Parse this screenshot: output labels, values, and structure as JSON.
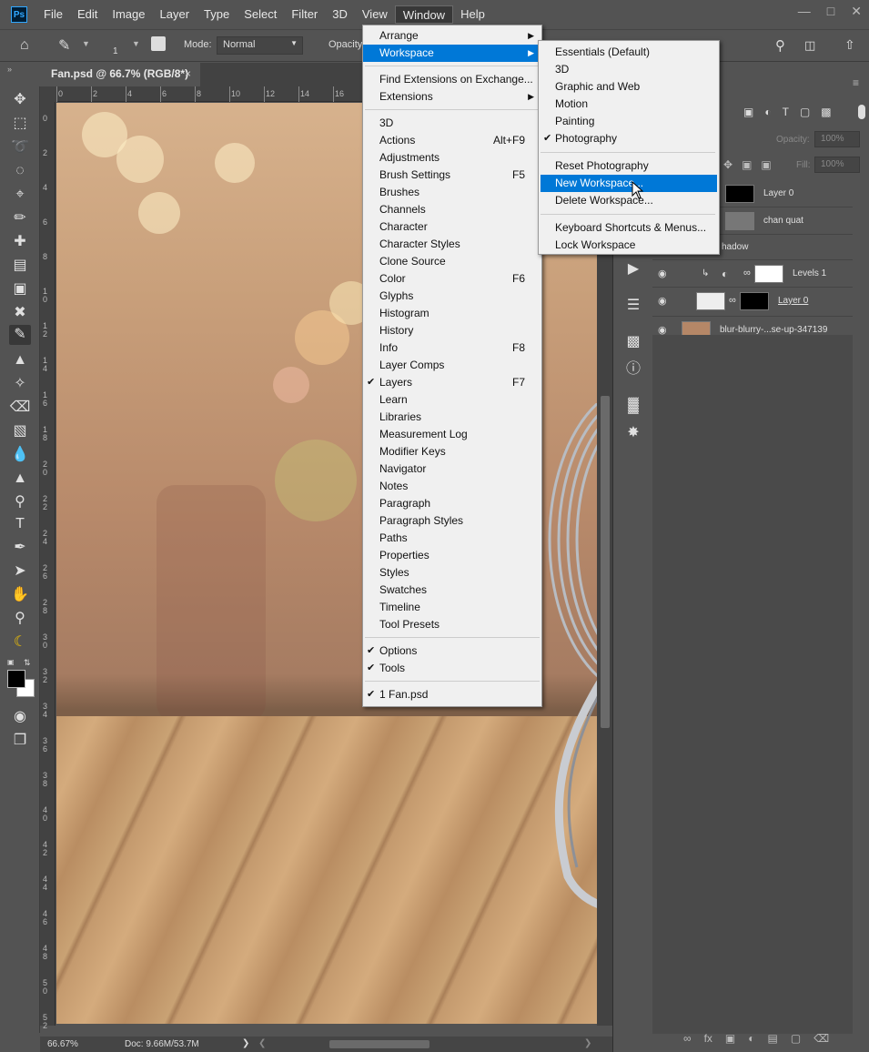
{
  "menubar": {
    "logo": "Ps",
    "items": [
      "File",
      "Edit",
      "Image",
      "Layer",
      "Type",
      "Select",
      "Filter",
      "3D",
      "View",
      "Window",
      "Help"
    ],
    "active_item": "Window"
  },
  "options": {
    "mode_label": "Mode:",
    "mode_value": "Normal",
    "opacity_label": "Opacity:",
    "brush_size": "1"
  },
  "document": {
    "tab_title": "Fan.psd @ 66.7% (RGB/8*)",
    "zoom": "66.67%",
    "doc_size": "Doc: 9.66M/53.7M",
    "hruler_ticks": [
      "0",
      "2",
      "4",
      "6",
      "8",
      "10",
      "12",
      "14",
      "16"
    ],
    "vruler_ticks": [
      "0",
      "2",
      "4",
      "6",
      "8",
      "1 0",
      "1 2",
      "1 4",
      "1 6",
      "1 8",
      "2 0",
      "2 2",
      "2 4",
      "2 6",
      "2 8",
      "3 0",
      "3 2",
      "3 4",
      "3 6",
      "3 8",
      "4 0",
      "4 2",
      "4 4",
      "4 6",
      "4 8",
      "5 0",
      "5 2"
    ]
  },
  "window_menu": {
    "items": [
      {
        "label": "Arrange",
        "submenu": true
      },
      {
        "label": "Workspace",
        "submenu": true,
        "highlighted": true
      },
      {
        "sep": true
      },
      {
        "label": "Find Extensions on Exchange..."
      },
      {
        "label": "Extensions",
        "submenu": true
      },
      {
        "sep": true
      },
      {
        "label": "3D"
      },
      {
        "label": "Actions",
        "shortcut": "Alt+F9"
      },
      {
        "label": "Adjustments"
      },
      {
        "label": "Brush Settings",
        "shortcut": "F5"
      },
      {
        "label": "Brushes"
      },
      {
        "label": "Channels"
      },
      {
        "label": "Character"
      },
      {
        "label": "Character Styles"
      },
      {
        "label": "Clone Source"
      },
      {
        "label": "Color",
        "shortcut": "F6"
      },
      {
        "label": "Glyphs"
      },
      {
        "label": "Histogram"
      },
      {
        "label": "History"
      },
      {
        "label": "Info",
        "shortcut": "F8"
      },
      {
        "label": "Layer Comps"
      },
      {
        "label": "Layers",
        "shortcut": "F7",
        "checked": true
      },
      {
        "label": "Learn"
      },
      {
        "label": "Libraries"
      },
      {
        "label": "Measurement Log"
      },
      {
        "label": "Modifier Keys"
      },
      {
        "label": "Navigator"
      },
      {
        "label": "Notes"
      },
      {
        "label": "Paragraph"
      },
      {
        "label": "Paragraph Styles"
      },
      {
        "label": "Paths"
      },
      {
        "label": "Properties"
      },
      {
        "label": "Styles"
      },
      {
        "label": "Swatches"
      },
      {
        "label": "Timeline"
      },
      {
        "label": "Tool Presets"
      },
      {
        "sep": true
      },
      {
        "label": "Options",
        "checked": true
      },
      {
        "label": "Tools",
        "checked": true
      },
      {
        "sep": true
      },
      {
        "label": "1 Fan.psd",
        "checked": true
      }
    ]
  },
  "workspace_menu": {
    "items": [
      {
        "label": "Essentials (Default)"
      },
      {
        "label": "3D"
      },
      {
        "label": "Graphic and Web"
      },
      {
        "label": "Motion"
      },
      {
        "label": "Painting"
      },
      {
        "label": "Photography",
        "checked": true
      },
      {
        "sep": true
      },
      {
        "label": "Reset Photography"
      },
      {
        "label": "New Workspace...",
        "highlighted": true
      },
      {
        "label": "Delete Workspace..."
      },
      {
        "sep": true
      },
      {
        "label": "Keyboard Shortcuts & Menus..."
      },
      {
        "label": "Lock Workspace"
      }
    ]
  },
  "layers_panel": {
    "opacity_label": "Opacity:",
    "opacity_value": "100%",
    "fill_label": "Fill:",
    "fill_value": "100%",
    "layers": [
      {
        "name": "Layer 0"
      },
      {
        "name": "chan quat"
      },
      {
        "name": "hadow"
      },
      {
        "name": "Levels 1"
      },
      {
        "name": "Layer 0"
      },
      {
        "name": "blur-blurry-...se-up-347139"
      }
    ]
  },
  "colors": {
    "highlight": "#0078d7",
    "panel_bg": "#535353",
    "menu_bg": "#f0f0f0"
  }
}
